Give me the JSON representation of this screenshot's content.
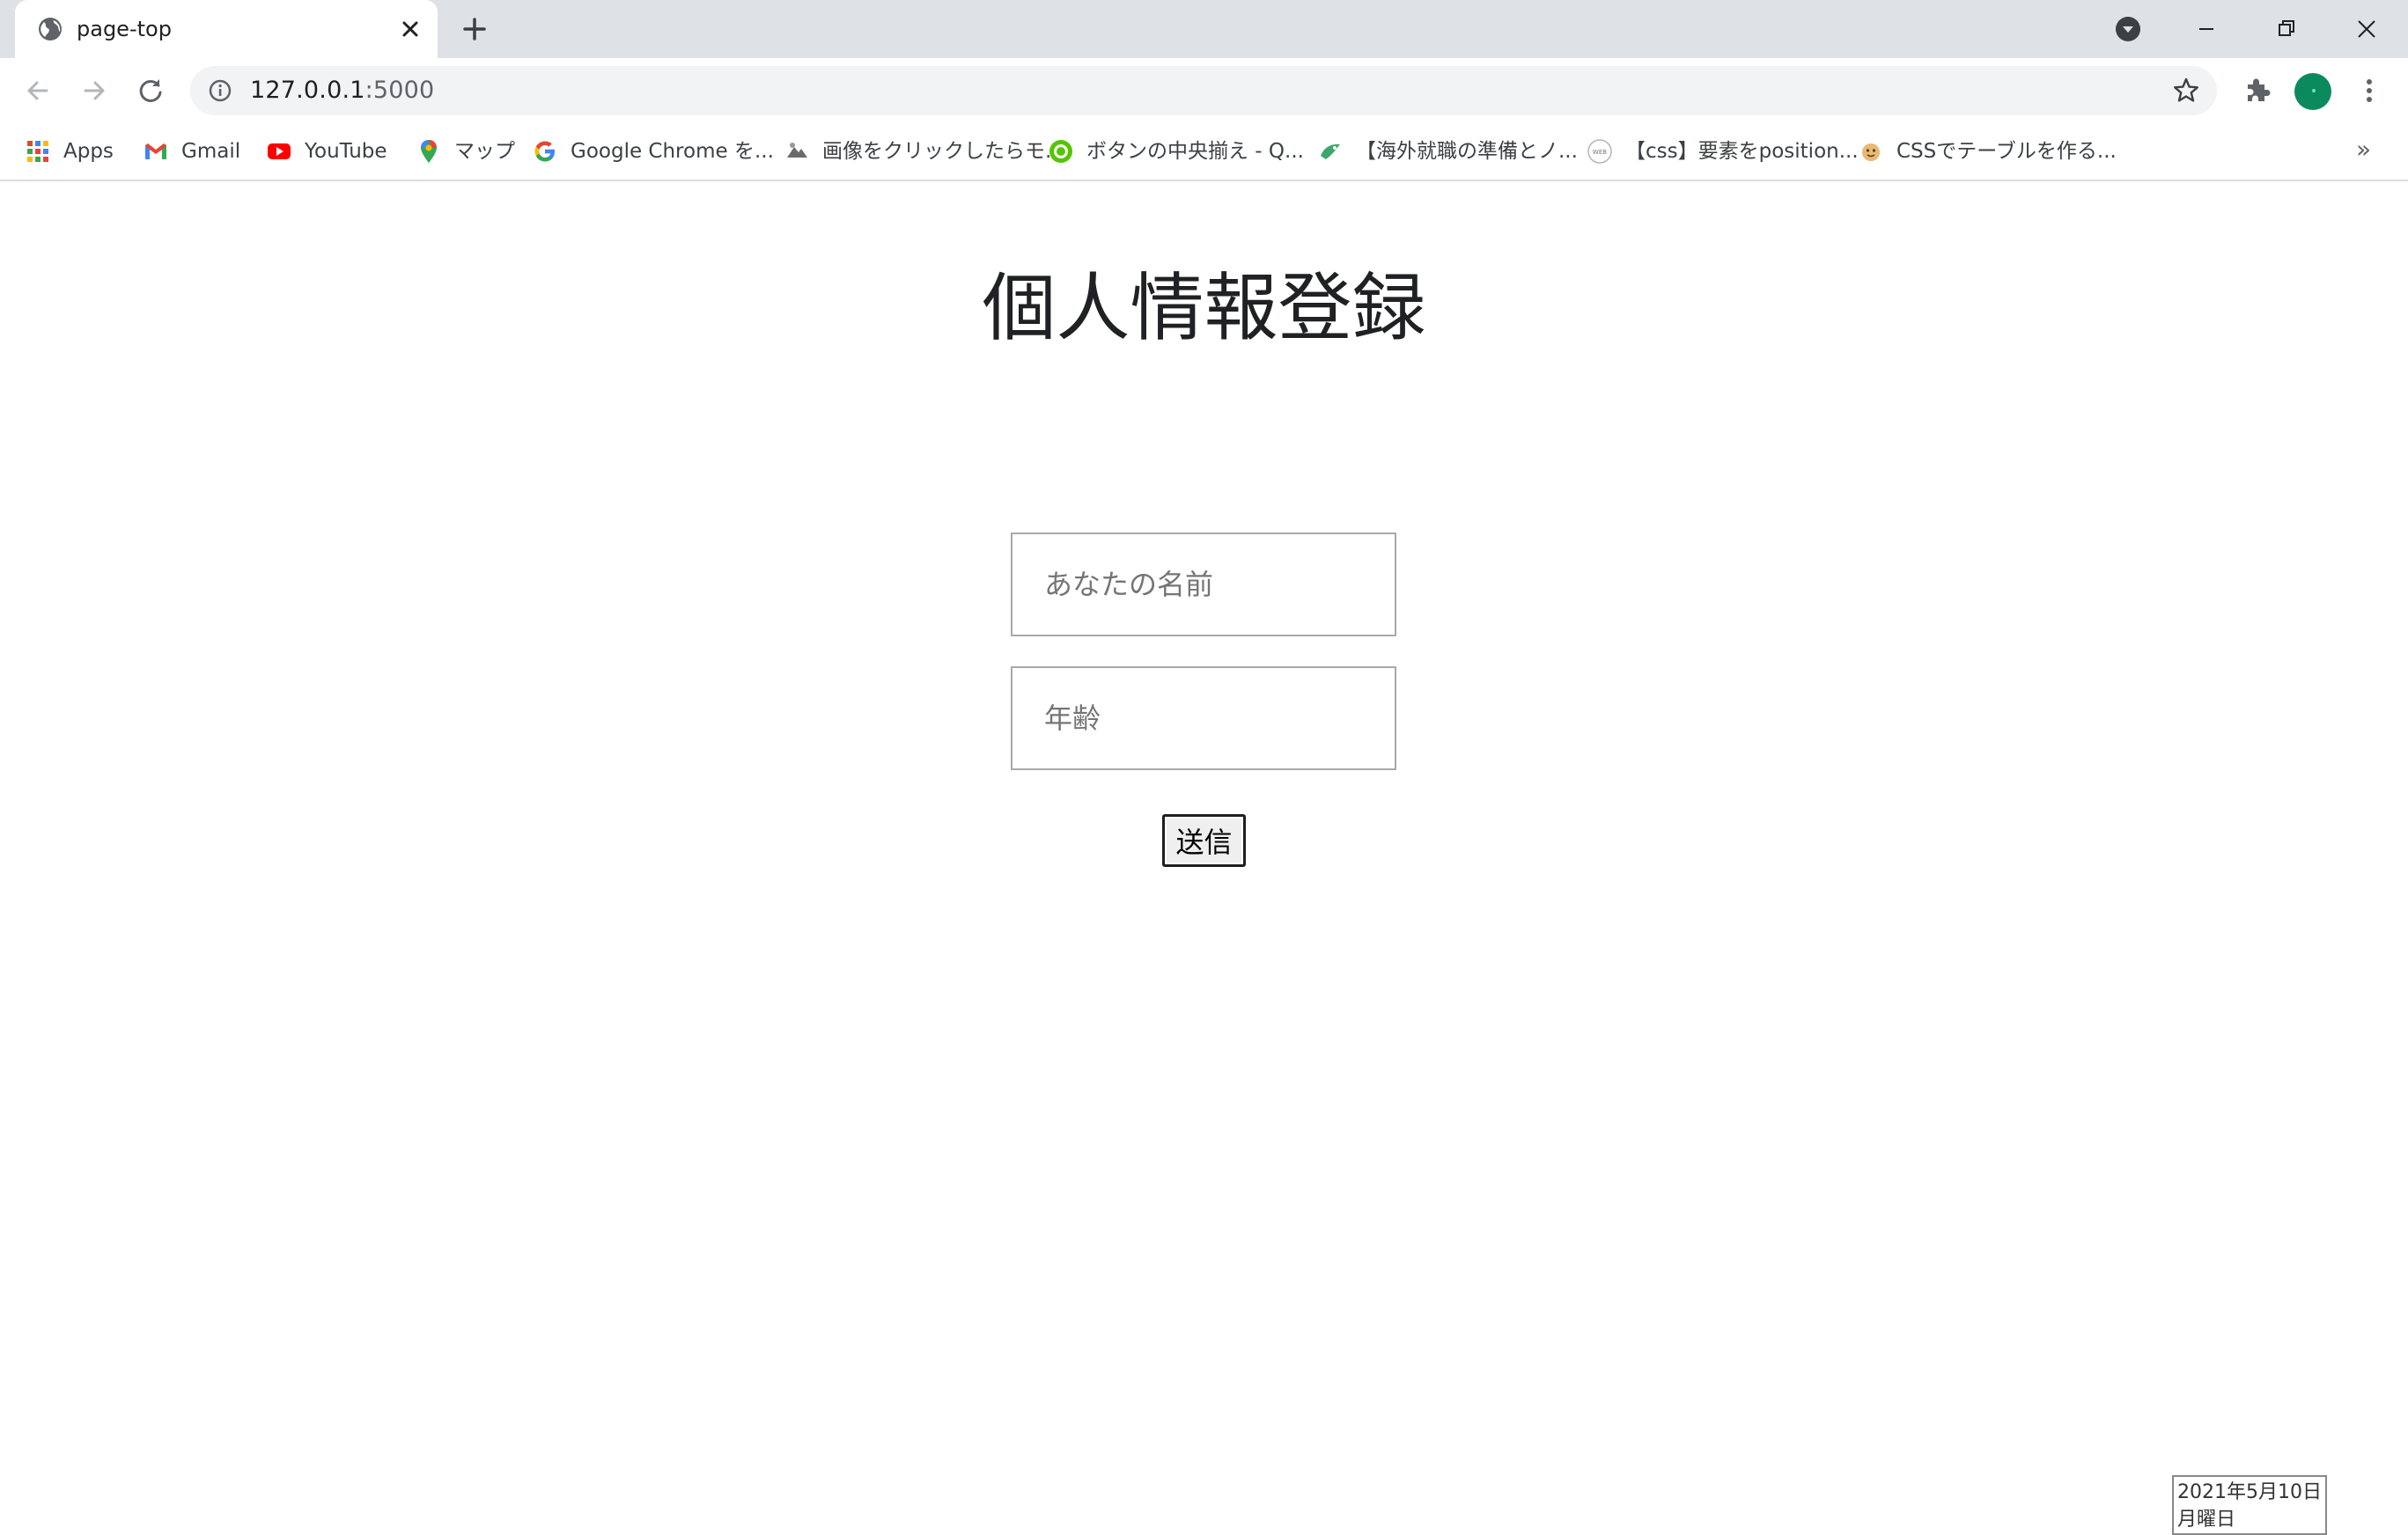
{
  "tab": {
    "title": "page-top",
    "favicon": "globe-icon"
  },
  "omnibox": {
    "url_host": "127.0.0.1",
    "url_port": ":5000"
  },
  "bookmarks": [
    {
      "label": "Apps",
      "icon": "apps-grid-icon"
    },
    {
      "label": "Gmail",
      "icon": "gmail-icon"
    },
    {
      "label": "YouTube",
      "icon": "youtube-icon"
    },
    {
      "label": "マップ",
      "icon": "maps-pin-icon"
    },
    {
      "label": "Google Chrome を...",
      "icon": "google-icon"
    },
    {
      "label": "画像をクリックしたらモ...",
      "icon": "site-icon"
    },
    {
      "label": "ボタンの中央揃え - Q...",
      "icon": "site-icon"
    },
    {
      "label": "【海外就職の準備とノ...",
      "icon": "site-icon"
    },
    {
      "label": "【css】要素をposition...",
      "icon": "site-icon"
    },
    {
      "label": "CSSでテーブルを作る...",
      "icon": "site-icon"
    }
  ],
  "page": {
    "title": "個人情報登録",
    "name_placeholder": "あなたの名前",
    "age_placeholder": "年齢",
    "submit_label": "送信"
  },
  "clock": {
    "date": "2021年5月10日",
    "weekday": "月曜日"
  },
  "colors": {
    "tabstrip_bg": "#dee1e6",
    "omnibox_bg": "#f1f3f4",
    "avatar": "#0b8a5e",
    "youtube_red": "#ff0000"
  }
}
